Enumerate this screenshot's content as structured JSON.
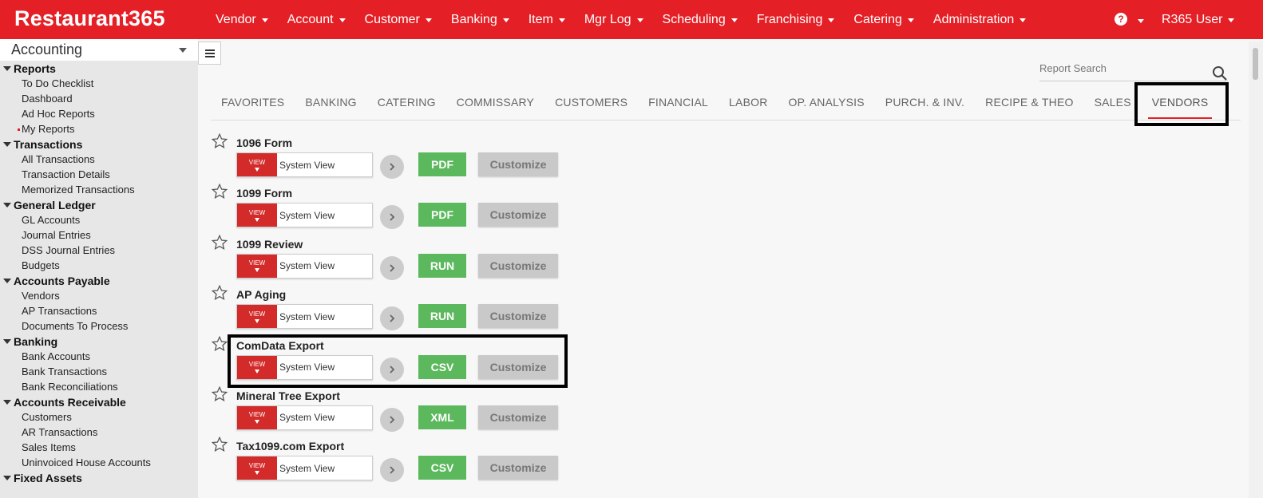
{
  "app": {
    "logo": "Restaurant365",
    "nav": [
      "Vendor",
      "Account",
      "Customer",
      "Banking",
      "Item",
      "Mgr Log",
      "Scheduling",
      "Franchising",
      "Catering",
      "Administration"
    ],
    "help_icon": "?",
    "user": "R365 User"
  },
  "sidebar": {
    "module": "Accounting",
    "sections": [
      {
        "title": "Reports",
        "items": [
          "To Do Checklist",
          "Dashboard",
          "Ad Hoc Reports",
          "My Reports"
        ]
      },
      {
        "title": "Transactions",
        "items": [
          "All Transactions",
          "Transaction Details",
          "Memorized Transactions"
        ]
      },
      {
        "title": "General Ledger",
        "items": [
          "GL Accounts",
          "Journal Entries",
          "DSS Journal Entries",
          "Budgets"
        ]
      },
      {
        "title": "Accounts Payable",
        "items": [
          "Vendors",
          "AP Transactions",
          "Documents To Process"
        ]
      },
      {
        "title": "Banking",
        "items": [
          "Bank Accounts",
          "Bank Transactions",
          "Bank Reconciliations"
        ]
      },
      {
        "title": "Accounts Receivable",
        "items": [
          "Customers",
          "AR Transactions",
          "Sales Items",
          "Uninvoiced House Accounts"
        ]
      },
      {
        "title": "Fixed Assets",
        "items": []
      }
    ]
  },
  "search": {
    "placeholder": "Report Search"
  },
  "tabs": [
    "FAVORITES",
    "BANKING",
    "CATERING",
    "COMMISSARY",
    "CUSTOMERS",
    "FINANCIAL",
    "LABOR",
    "OP. ANALYSIS",
    "PURCH. & INV.",
    "RECIPE & THEO",
    "SALES",
    "VENDORS"
  ],
  "active_tab": "VENDORS",
  "view_label": "VIEW",
  "customize_label": "Customize",
  "reports": [
    {
      "name": "1096 Form",
      "view": "System View",
      "action": "PDF"
    },
    {
      "name": "1099 Form",
      "view": "System View",
      "action": "PDF"
    },
    {
      "name": "1099 Review",
      "view": "System View",
      "action": "RUN"
    },
    {
      "name": "AP Aging",
      "view": "System View",
      "action": "RUN"
    },
    {
      "name": "ComData Export",
      "view": "System View",
      "action": "CSV"
    },
    {
      "name": "Mineral Tree Export",
      "view": "System View",
      "action": "XML"
    },
    {
      "name": "Tax1099.com Export",
      "view": "System View",
      "action": "CSV"
    }
  ],
  "colors": {
    "brand": "#e41f26",
    "action": "#5cb85c",
    "customize": "#c9c9c9",
    "view": "#d32a2a"
  }
}
